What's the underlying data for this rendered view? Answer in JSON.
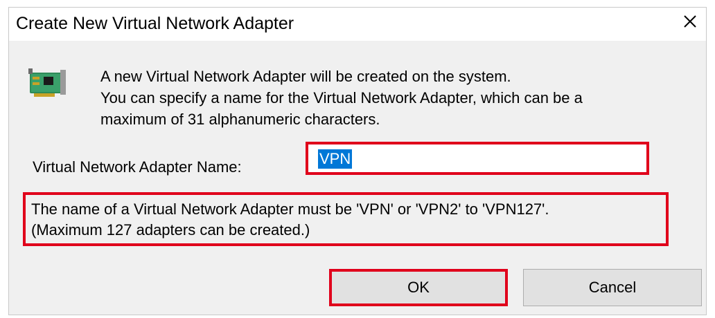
{
  "window": {
    "title": "Create New Virtual Network Adapter"
  },
  "info": {
    "lines": [
      "A new Virtual Network Adapter will be created on the system.",
      "You can specify a name for the Virtual Network Adapter, which can be a",
      "maximum of 31 alphanumeric characters."
    ]
  },
  "name_field": {
    "label": "Virtual Network Adapter Name:",
    "value": "VPN"
  },
  "rule": {
    "lines": [
      "The name of a Virtual Network Adapter must be 'VPN' or 'VPN2' to 'VPN127'.",
      "(Maximum 127 adapters can be created.)"
    ]
  },
  "buttons": {
    "ok_label": "OK",
    "cancel_label": "Cancel"
  },
  "icons": {
    "close": "close-icon",
    "adapter": "network-adapter-icon"
  },
  "colors": {
    "highlight_border": "#e0001b",
    "selection": "#0078d7",
    "client_background": "#f0f0f0",
    "button_background": "#e1e1e1"
  }
}
